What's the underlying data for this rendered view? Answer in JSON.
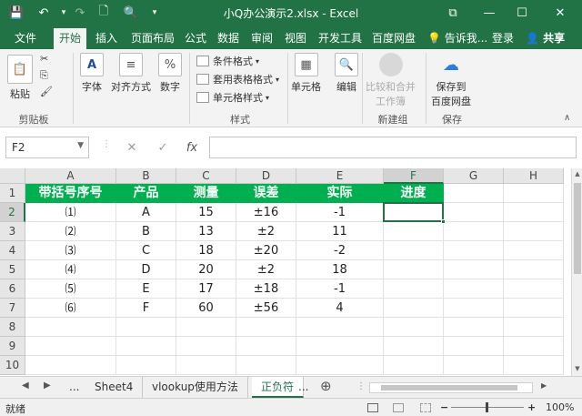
{
  "window": {
    "title": "小Q办公演示2.xlsx - Excel",
    "restore_label": "⧉",
    "minimize_label": "—",
    "maximize_label": "☐",
    "close_label": "✕"
  },
  "quick_access": {
    "save": "💾",
    "undo": "↶",
    "redo": "↷",
    "new": "🗋",
    "print_preview": "🔍",
    "customize": "▾"
  },
  "tabs": [
    "文件",
    "开始",
    "插入",
    "页面布局",
    "公式",
    "数据",
    "审阅",
    "视图",
    "开发工具",
    "百度网盘"
  ],
  "active_tab": "开始",
  "tell_me": "告诉我...",
  "login": "登录",
  "share": "共享",
  "ribbon": {
    "paste": "粘贴",
    "clipboard_group": "剪贴板",
    "font": "字体",
    "alignment": "对齐方式",
    "number": "数字",
    "conditional_format": "条件格式",
    "table_format": "套用表格格式",
    "cell_style": "单元格样式",
    "style_group": "样式",
    "cells": "单元格",
    "edit": "编辑",
    "compare_merge_l1": "比较和合并",
    "compare_merge_l2": "工作簿",
    "new_group": "新建组",
    "save_baidu_l1": "保存到",
    "save_baidu_l2": "百度网盘",
    "save_group": "保存"
  },
  "formula_bar": {
    "name_box": "F2",
    "cancel": "✕",
    "enter": "✓",
    "fx": "fx",
    "formula": ""
  },
  "columns": [
    "A",
    "B",
    "C",
    "D",
    "E",
    "F",
    "G",
    "H"
  ],
  "rows": [
    "1",
    "2",
    "3",
    "4",
    "5",
    "6",
    "7",
    "8",
    "9",
    "10"
  ],
  "table": {
    "headers": [
      "带括号序号",
      "产品",
      "测量",
      "误差",
      "实际",
      "进度"
    ],
    "data": [
      [
        "⑴",
        "A",
        "15",
        "±16",
        "-1",
        ""
      ],
      [
        "⑵",
        "B",
        "13",
        "±2",
        "11",
        ""
      ],
      [
        "⑶",
        "C",
        "18",
        "±20",
        "-2",
        ""
      ],
      [
        "⑷",
        "D",
        "20",
        "±2",
        "18",
        ""
      ],
      [
        "⑸",
        "E",
        "17",
        "±18",
        "-1",
        ""
      ],
      [
        "⑹",
        "F",
        "60",
        "±56",
        "4",
        ""
      ]
    ]
  },
  "sheets": [
    "...",
    "Sheet4",
    "vlookup使用方法",
    "正负符"
  ],
  "active_sheet": "正负符",
  "sheet_more": "...",
  "add_sheet": "⊕",
  "status": {
    "ready": "就绪",
    "zoom": "100%",
    "zoom_minus": "−",
    "zoom_plus": "+"
  }
}
